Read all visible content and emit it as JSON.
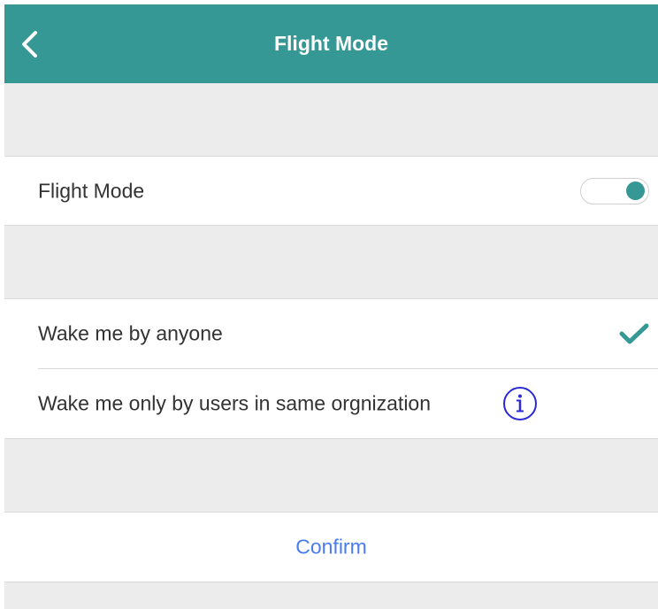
{
  "header": {
    "title": "Flight Mode",
    "back_icon": "chevron-left-icon",
    "background_color": "#359895"
  },
  "flight_mode": {
    "label": "Flight Mode",
    "enabled": true,
    "accent_color": "#359895"
  },
  "wake_options": {
    "items": [
      {
        "label": "Wake me by anyone",
        "selected": true
      },
      {
        "label": "Wake me only by users in same orgnization",
        "selected": false,
        "info_icon": "info-icon"
      }
    ],
    "check_icon": "checkmark-icon"
  },
  "confirm": {
    "label": "Confirm",
    "color": "#4a7cf1"
  }
}
